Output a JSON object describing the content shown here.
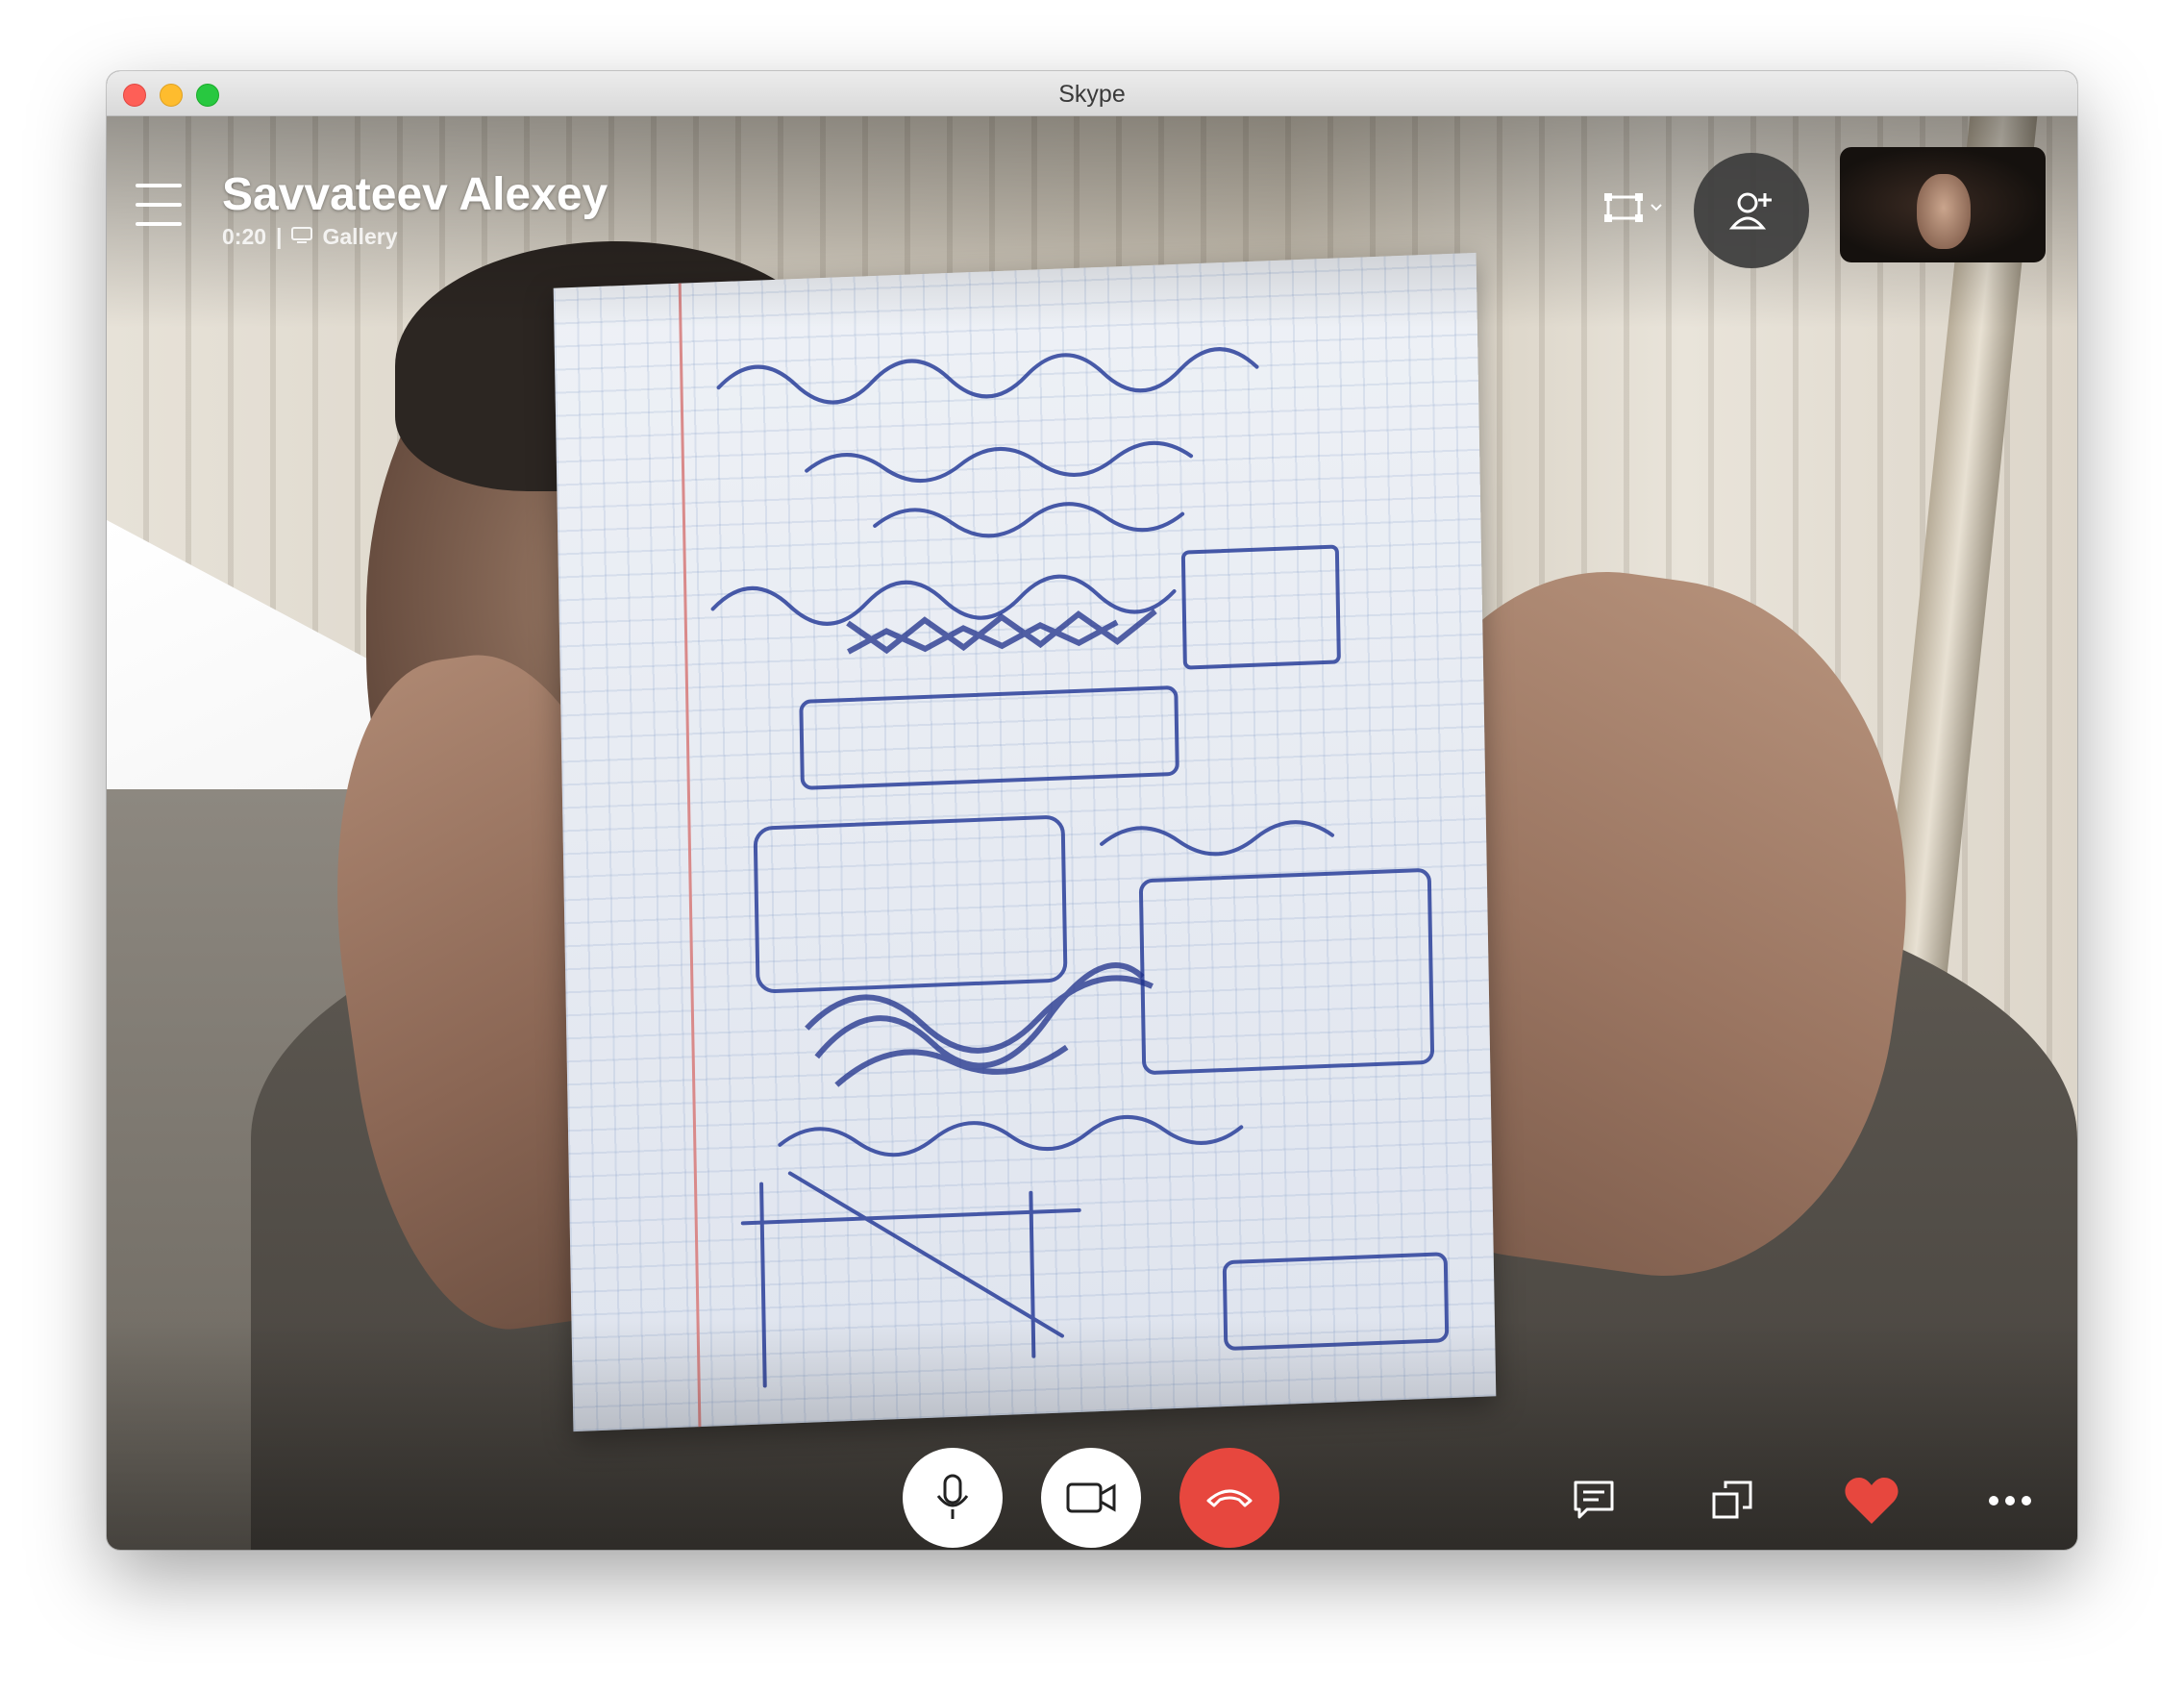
{
  "window": {
    "title": "Skype"
  },
  "call": {
    "contact_name": "Savvateev Alexey",
    "duration": "0:20",
    "separator": "|",
    "layout_label": "Gallery"
  },
  "controls": {
    "icons": {
      "menu": "hamburger-icon",
      "fullscreen": "fullscreen-icon",
      "add_participant": "add-person-icon",
      "mic": "microphone-icon",
      "camera": "video-camera-icon",
      "end_call": "hang-up-icon",
      "chat": "chat-icon",
      "share_screen": "share-screen-icon",
      "react": "heart-icon",
      "more": "more-options-icon"
    }
  },
  "colors": {
    "end_call": "#e7473e",
    "heart": "#e7473e",
    "button_bg": "#ffffff"
  }
}
